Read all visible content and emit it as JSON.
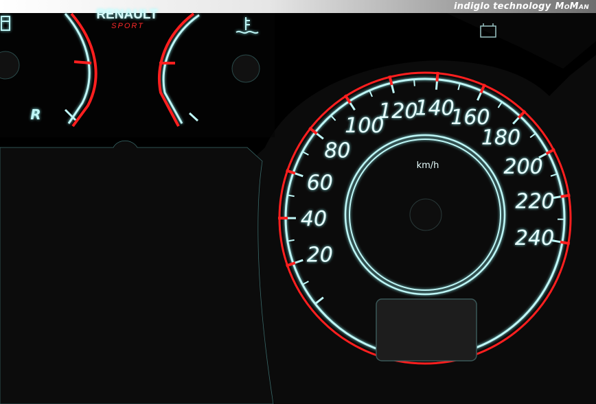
{
  "banner": {
    "caption": "indiglo technology",
    "brand": "MoMan"
  },
  "logo": {
    "line1": "RENAULT",
    "line2": "SPORT"
  },
  "gear_indicator": "R",
  "speedometer": {
    "unit": "km/h",
    "labels": [
      "20",
      "40",
      "60",
      "80",
      "100",
      "120",
      "140",
      "160",
      "180",
      "200",
      "220",
      "240"
    ]
  },
  "colors": {
    "glow": "#bff6f6",
    "red": "#ff1f1f",
    "face": "#0a0a0a",
    "background": "#000000"
  },
  "icons": [
    "coolant-temperature-icon",
    "fuel-pump-icon",
    "battery-icon"
  ]
}
